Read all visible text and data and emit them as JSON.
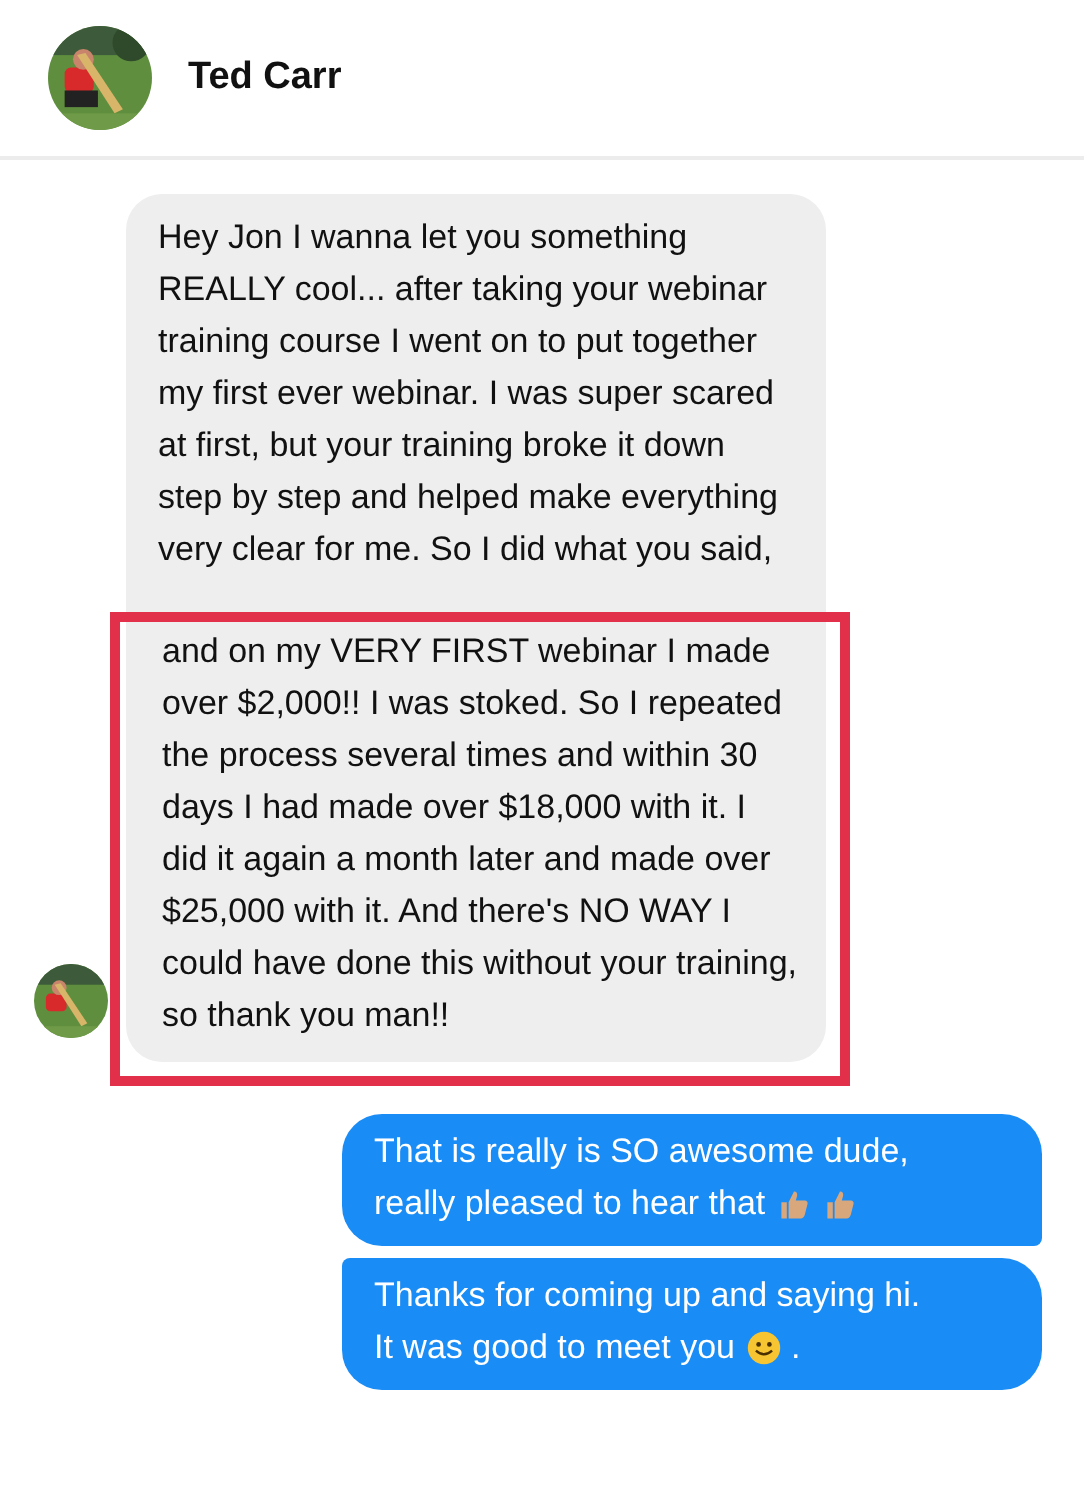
{
  "header": {
    "name": "Ted Carr"
  },
  "incoming": {
    "text": "Hey Jon I wanna let you something REALLY cool... after taking your webinar training course I went on to put together my first ever webinar. I was super scared at first, but your training broke it down step by step and helped make everything very clear for me. So I did what you said,",
    "highlighted_text": "and on my VERY FIRST webinar I made over $2,000!! I was stoked. So I repeated the process several times and within 30 days I had made over $18,000 with it. I did it again a month later and made over $25,000 with it. And there's NO WAY I could have done this without your training, so thank you man!!"
  },
  "outgoing": [
    {
      "lines": [
        [
          {
            "kind": "text",
            "text": "That is really is SO awesome dude,"
          }
        ],
        [
          {
            "kind": "text",
            "text": "really pleased to hear that"
          },
          {
            "kind": "thumbs-up"
          },
          {
            "kind": "thumbs-up"
          }
        ]
      ]
    },
    {
      "lines": [
        [
          {
            "kind": "text",
            "text": "Thanks for coming up and saying hi."
          }
        ],
        [
          {
            "kind": "text",
            "text": "It was good to meet you"
          },
          {
            "kind": "smiley"
          },
          {
            "kind": "text",
            "text": "."
          }
        ]
      ]
    }
  ]
}
